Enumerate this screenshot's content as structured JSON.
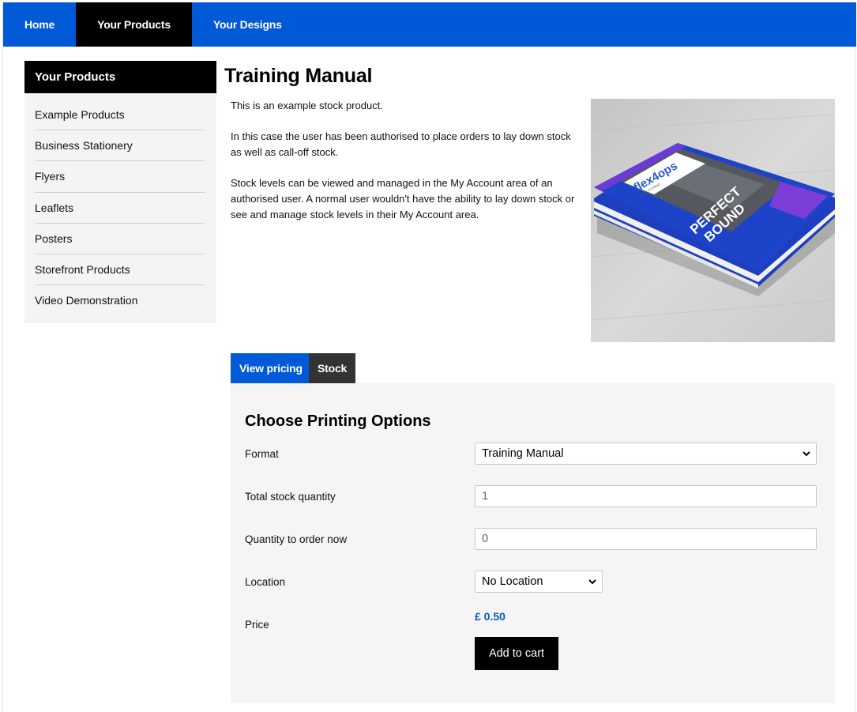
{
  "nav": {
    "items": [
      {
        "label": "Home"
      },
      {
        "label": "Your Products"
      },
      {
        "label": "Your Designs"
      }
    ],
    "active_index": 1
  },
  "sidebar": {
    "title": "Your Products",
    "items": [
      {
        "label": "Example Products"
      },
      {
        "label": "Business Stationery"
      },
      {
        "label": "Flyers"
      },
      {
        "label": "Leaflets"
      },
      {
        "label": "Posters"
      },
      {
        "label": "Storefront Products"
      },
      {
        "label": "Video Demonstration"
      }
    ]
  },
  "product": {
    "title": "Training Manual",
    "description": [
      "This is an example stock product.",
      "In this case the user has been authorised to place orders to lay down stock as well as call-off stock.",
      "Stock levels can be viewed and managed in the My Account area of an authorised user. A normal user wouldn't have the ability to lay down stock or see and manage stock levels in their My Account area."
    ],
    "image": {
      "brand": "flex4ops",
      "tagline": "WEB TO PRINT",
      "cover_text_1": "PERFECT",
      "cover_text_2": "BOUND"
    }
  },
  "tabs": [
    {
      "label": "View pricing"
    },
    {
      "label": "Stock"
    }
  ],
  "options": {
    "title": "Choose Printing Options",
    "format_label": "Format",
    "format_value": "Training Manual",
    "total_stock_label": "Total stock quantity",
    "total_stock_value": "1",
    "order_now_label": "Quantity to order now",
    "order_now_value": "0",
    "location_label": "Location",
    "location_value": "No Location",
    "price_label": "Price",
    "price_value": "£ 0.50",
    "add_to_cart": "Add to cart"
  },
  "colors": {
    "brand_blue": "#0059d6",
    "price_blue": "#0a55c4",
    "black": "#000000",
    "panel_bg": "#f5f5f5"
  }
}
